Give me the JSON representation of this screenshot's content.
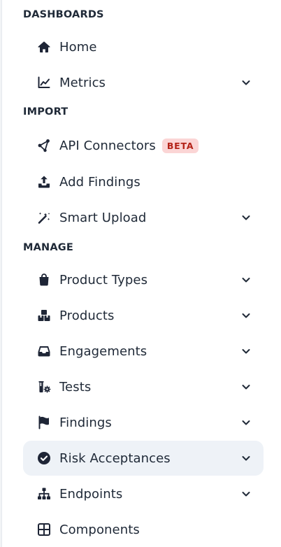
{
  "sections": {
    "dashboards": "DASHBOARDS",
    "import": "IMPORT",
    "manage": "MANAGE"
  },
  "items": {
    "home": {
      "label": "Home",
      "icon": "home-icon"
    },
    "metrics": {
      "label": "Metrics",
      "icon": "chart-line-icon"
    },
    "api_connectors": {
      "label": "API Connectors",
      "icon": "nodes-icon",
      "badge": "BETA"
    },
    "add_findings": {
      "label": "Add Findings",
      "icon": "upload-icon"
    },
    "smart_upload": {
      "label": "Smart Upload",
      "icon": "magic-wand-icon"
    },
    "product_types": {
      "label": "Product Types",
      "icon": "shopping-bag-icon"
    },
    "products": {
      "label": "Products",
      "icon": "boxes-icon"
    },
    "engagements": {
      "label": "Engagements",
      "icon": "inbox-icon"
    },
    "tests": {
      "label": "Tests",
      "icon": "flask-gear-icon"
    },
    "findings": {
      "label": "Findings",
      "icon": "flag-icon"
    },
    "risk_acceptances": {
      "label": "Risk Acceptances",
      "icon": "check-circle-icon",
      "active": true
    },
    "endpoints": {
      "label": "Endpoints",
      "icon": "sitemap-icon"
    },
    "components": {
      "label": "Components",
      "icon": "table-icon"
    }
  },
  "colors": {
    "text": "#1f2937",
    "active_bg": "#eef2f7",
    "badge_bg": "#fbd5d5",
    "badge_text": "#b42318"
  }
}
